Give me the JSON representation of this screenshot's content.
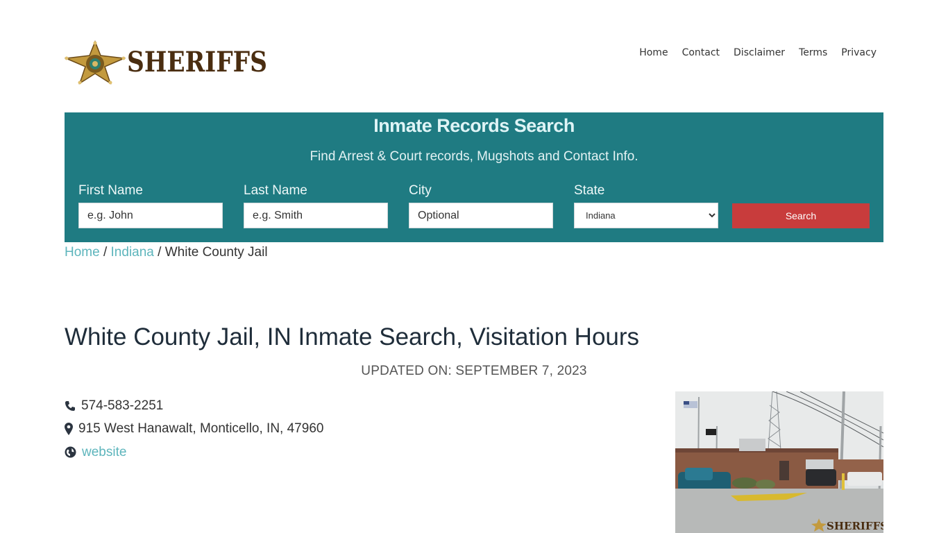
{
  "header": {
    "logo_text": "SHERIFFS",
    "nav": [
      "Home",
      "Contact",
      "Disclaimer",
      "Terms",
      "Privacy"
    ]
  },
  "search": {
    "title": "Inmate Records Search",
    "subtitle": "Find Arrest & Court records, Mugshots and Contact Info.",
    "first_name_label": "First Name",
    "first_name_placeholder": "e.g. John",
    "last_name_label": "Last Name",
    "last_name_placeholder": "e.g. Smith",
    "city_label": "City",
    "city_placeholder": "Optional",
    "state_label": "State",
    "state_value": "Indiana",
    "button_label": "Search"
  },
  "breadcrumb": {
    "home": "Home",
    "separator": "/",
    "state": "Indiana",
    "current": "White County Jail"
  },
  "page": {
    "title": "White County Jail, IN Inmate Search, Visitation Hours",
    "updated": "UPDATED ON: SEPTEMBER 7, 2023"
  },
  "contact": {
    "phone": "574-583-2251",
    "address": "915 West Hanawalt, Monticello, IN, 47960",
    "website_label": "website"
  },
  "photo": {
    "watermark": "SHERIFFS"
  },
  "colors": {
    "panel": "#1f7b82",
    "button": "#c83c3c",
    "link": "#5db5bc",
    "logo": "#4a2d10"
  }
}
